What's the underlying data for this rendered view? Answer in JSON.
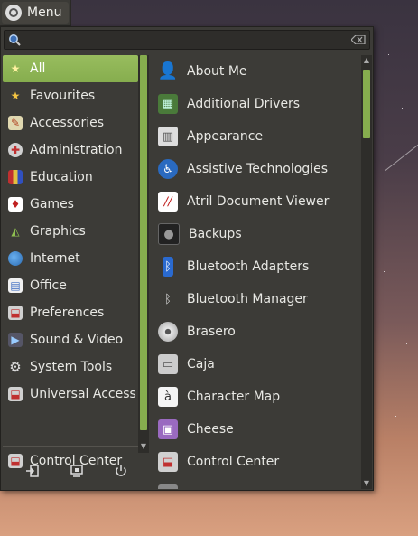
{
  "panel": {
    "menu_label": "Menu"
  },
  "search": {
    "value": "",
    "placeholder": ""
  },
  "categories": [
    {
      "label": "All",
      "icon": "all-icon",
      "active": true
    },
    {
      "label": "Favourites",
      "icon": "star-icon"
    },
    {
      "label": "Accessories",
      "icon": "accessories-icon"
    },
    {
      "label": "Administration",
      "icon": "administration-icon"
    },
    {
      "label": "Education",
      "icon": "education-icon"
    },
    {
      "label": "Games",
      "icon": "games-icon"
    },
    {
      "label": "Graphics",
      "icon": "graphics-icon"
    },
    {
      "label": "Internet",
      "icon": "globe-icon"
    },
    {
      "label": "Office",
      "icon": "office-icon"
    },
    {
      "label": "Preferences",
      "icon": "preferences-icon"
    },
    {
      "label": "Sound & Video",
      "icon": "sound-video-icon"
    },
    {
      "label": "System Tools",
      "icon": "gear-icon"
    },
    {
      "label": "Universal Access",
      "icon": "universal-access-icon"
    }
  ],
  "control_center": {
    "label": "Control Center",
    "icon": "control-center-icon"
  },
  "session": [
    {
      "name": "logout-icon"
    },
    {
      "name": "lock-screen-icon"
    },
    {
      "name": "power-icon"
    }
  ],
  "applications": [
    {
      "label": "About Me",
      "icon": "user-icon"
    },
    {
      "label": "Additional Drivers",
      "icon": "driver-chip-icon"
    },
    {
      "label": "Appearance",
      "icon": "appearance-icon"
    },
    {
      "label": "Assistive Technologies",
      "icon": "accessibility-icon"
    },
    {
      "label": "Atril Document Viewer",
      "icon": "document-viewer-icon"
    },
    {
      "label": "Backups",
      "icon": "backup-safe-icon"
    },
    {
      "label": "Bluetooth Adapters",
      "icon": "bluetooth-adapter-icon"
    },
    {
      "label": "Bluetooth Manager",
      "icon": "bluetooth-icon"
    },
    {
      "label": "Brasero",
      "icon": "disc-icon"
    },
    {
      "label": "Caja",
      "icon": "file-cabinet-icon"
    },
    {
      "label": "Character Map",
      "icon": "character-map-icon"
    },
    {
      "label": "Cheese",
      "icon": "webcam-icon"
    },
    {
      "label": "Control Center",
      "icon": "control-center-icon"
    },
    {
      "label": "",
      "icon": "partial-item-icon"
    }
  ],
  "colors": {
    "accent": "#86ad4e",
    "menu_bg": "#3c3b37",
    "panel_bg": "#3b3a36"
  }
}
